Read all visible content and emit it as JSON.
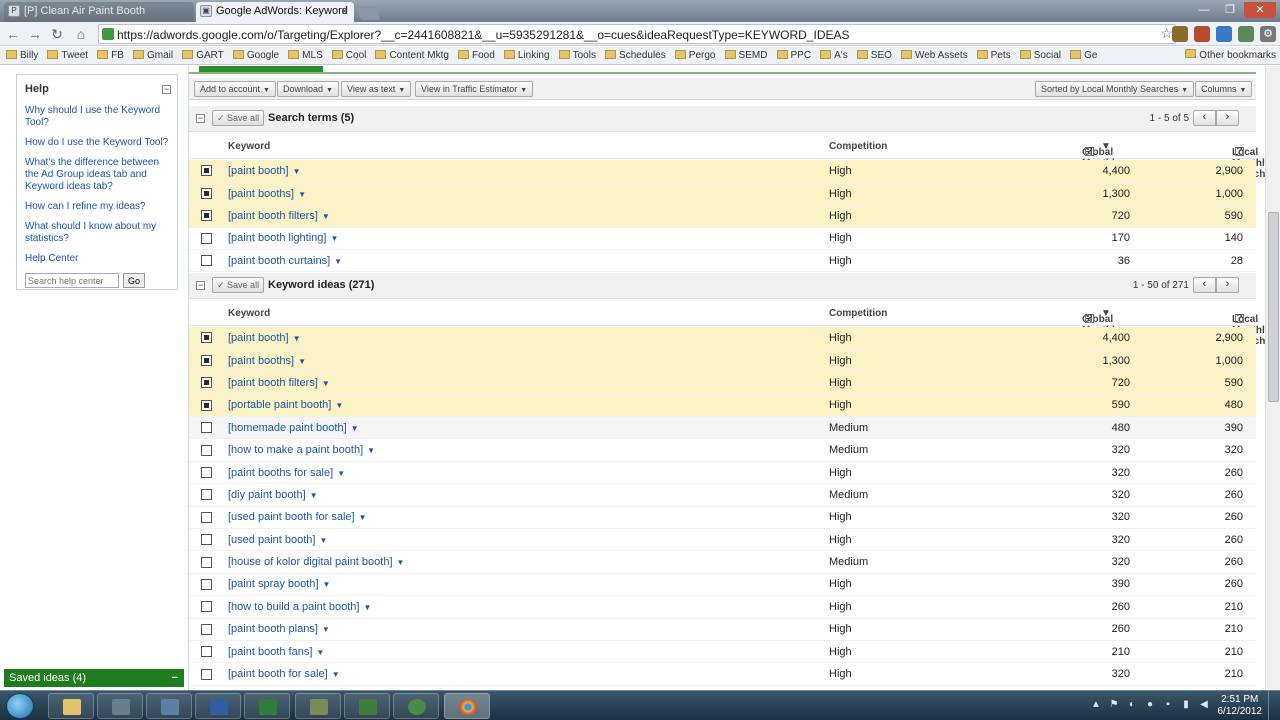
{
  "browser": {
    "tabs": [
      {
        "title": "[P] Clean Air Paint Booth",
        "active": false
      },
      {
        "title": "Google AdWords: Keyword",
        "active": true
      }
    ],
    "url": "https://adwords.google.com/o/Targeting/Explorer?__c=2441608821&__u=5935291281&__o=cues&ideaRequestType=KEYWORD_IDEAS",
    "bookmarks": [
      "Billy",
      "Tweet",
      "FB",
      "Gmail",
      "GART",
      "Google",
      "MLS",
      "Cool",
      "Content Mktg",
      "Food",
      "Linking",
      "Tools",
      "Schedules",
      "Pergo",
      "SEMD",
      "PPC",
      "A's",
      "SEO",
      "Web Assets",
      "Pets",
      "Social",
      "Ge"
    ],
    "other_bookmarks": "Other bookmarks"
  },
  "help": {
    "title": "Help",
    "links": [
      "Why should I use the Keyword Tool?",
      "How do I use the Keyword Tool?",
      "What's the difference between the Ad Group ideas tab and Keyword ideas tab?",
      "How can I refine my ideas?",
      "What should I know about my statistics?",
      "Help Center"
    ],
    "search_placeholder": "Search help center",
    "go_label": "Go"
  },
  "toolbar": {
    "add_to_account": "Add to account",
    "download": "Download",
    "view_as_text": "View as text",
    "view_in_traffic": "View in Traffic Estimator",
    "sorted_by": "Sorted by Local Monthly Searches",
    "columns": "Columns"
  },
  "columns": {
    "keyword": "Keyword",
    "competition": "Competition",
    "global": "Global Monthly Searches",
    "local": "Local Monthly Searches",
    "help_mark": "?"
  },
  "search_terms": {
    "save_all": "Save all",
    "title": "Search terms (5)",
    "pager": "1 - 5 of 5",
    "rows": [
      {
        "keyword": "[paint booth]",
        "competition": "High",
        "global": "4,400",
        "local": "2,900",
        "checked": true
      },
      {
        "keyword": "[paint booths]",
        "competition": "High",
        "global": "1,300",
        "local": "1,000",
        "checked": true
      },
      {
        "keyword": "[paint booth filters]",
        "competition": "High",
        "global": "720",
        "local": "590",
        "checked": true
      },
      {
        "keyword": "[paint booth lighting]",
        "competition": "High",
        "global": "170",
        "local": "140",
        "checked": false
      },
      {
        "keyword": "[paint booth curtains]",
        "competition": "High",
        "global": "36",
        "local": "28",
        "checked": false
      }
    ]
  },
  "keyword_ideas": {
    "save_all": "Save all",
    "title": "Keyword ideas (271)",
    "pager": "1 - 50 of 271",
    "rows": [
      {
        "keyword": "[paint booth]",
        "competition": "High",
        "global": "4,400",
        "local": "2,900",
        "checked": true
      },
      {
        "keyword": "[paint booths]",
        "competition": "High",
        "global": "1,300",
        "local": "1,000",
        "checked": true
      },
      {
        "keyword": "[paint booth filters]",
        "competition": "High",
        "global": "720",
        "local": "590",
        "checked": true
      },
      {
        "keyword": "[portable paint booth]",
        "competition": "High",
        "global": "590",
        "local": "480",
        "checked": true
      },
      {
        "keyword": "[homemade paint booth]",
        "competition": "Medium",
        "global": "480",
        "local": "390",
        "checked": false
      },
      {
        "keyword": "[how to make a paint booth]",
        "competition": "Medium",
        "global": "320",
        "local": "320",
        "checked": false
      },
      {
        "keyword": "[paint booths for sale]",
        "competition": "High",
        "global": "320",
        "local": "260",
        "checked": false
      },
      {
        "keyword": "[diy paint booth]",
        "competition": "Medium",
        "global": "320",
        "local": "260",
        "checked": false
      },
      {
        "keyword": "[used paint booth for sale]",
        "competition": "High",
        "global": "320",
        "local": "260",
        "checked": false
      },
      {
        "keyword": "[used paint booth]",
        "competition": "High",
        "global": "320",
        "local": "260",
        "checked": false
      },
      {
        "keyword": "[house of kolor digital paint booth]",
        "competition": "Medium",
        "global": "320",
        "local": "260",
        "checked": false
      },
      {
        "keyword": "[paint spray booth]",
        "competition": "High",
        "global": "390",
        "local": "260",
        "checked": false
      },
      {
        "keyword": "[how to build a paint booth]",
        "competition": "High",
        "global": "260",
        "local": "210",
        "checked": false
      },
      {
        "keyword": "[paint booth plans]",
        "competition": "High",
        "global": "260",
        "local": "210",
        "checked": false
      },
      {
        "keyword": "[paint booth fans]",
        "competition": "High",
        "global": "210",
        "local": "210",
        "checked": false
      },
      {
        "keyword": "[paint booth for sale]",
        "competition": "High",
        "global": "320",
        "local": "210",
        "checked": false
      }
    ]
  },
  "saved_ideas": "Saved ideas (4)",
  "clock": {
    "time": "2:51 PM",
    "date": "6/12/2012"
  }
}
